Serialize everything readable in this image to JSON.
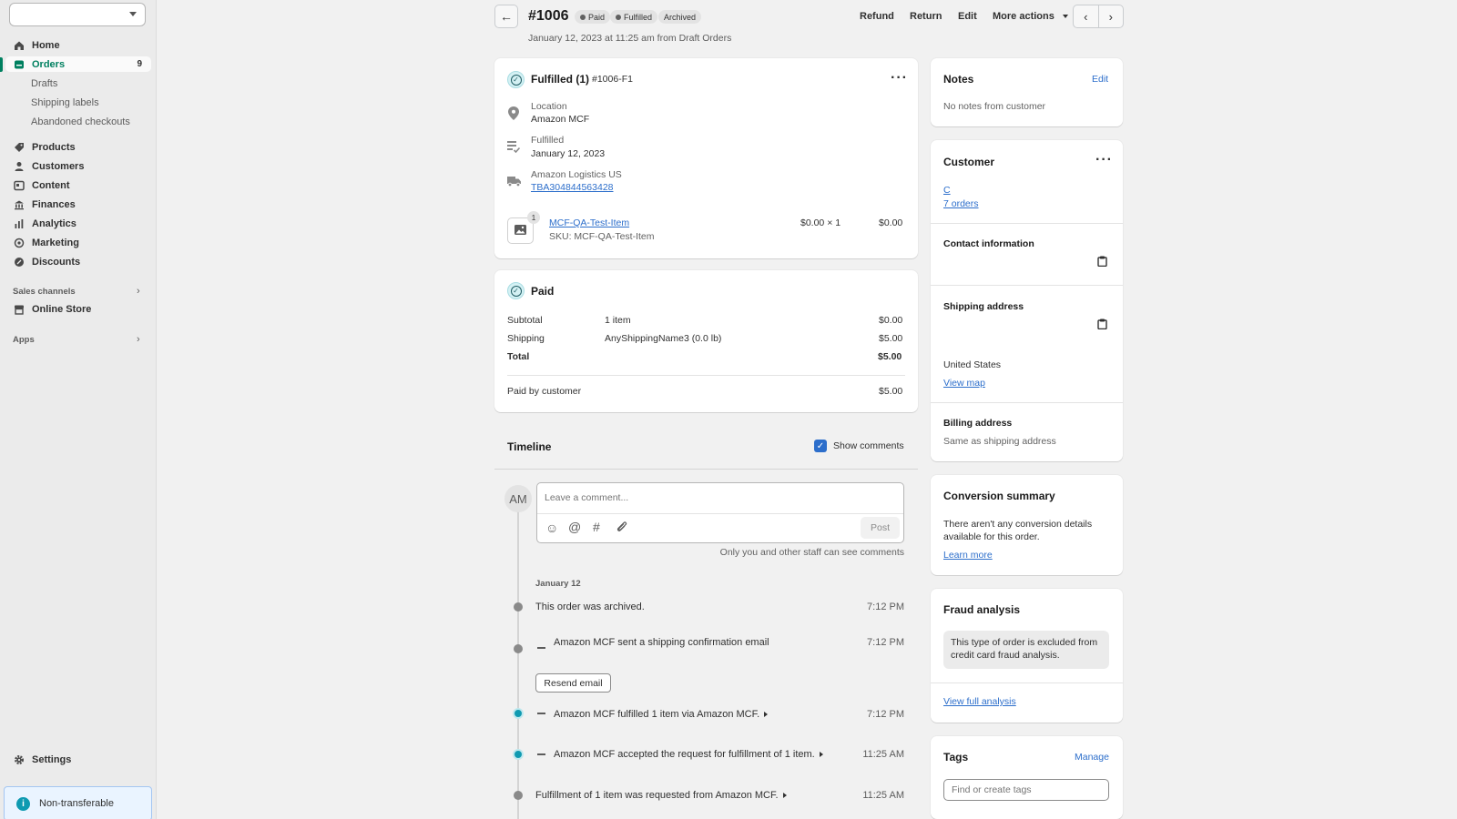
{
  "sidebar": {
    "store_select_value": "",
    "items": [
      {
        "label": "Home",
        "icon": "home-icon"
      },
      {
        "label": "Orders",
        "icon": "orders-icon",
        "badge": "9"
      },
      {
        "label": "Products",
        "icon": "tag-icon"
      },
      {
        "label": "Customers",
        "icon": "person-icon"
      },
      {
        "label": "Content",
        "icon": "content-icon"
      },
      {
        "label": "Finances",
        "icon": "bank-icon"
      },
      {
        "label": "Analytics",
        "icon": "bar-chart-icon"
      },
      {
        "label": "Marketing",
        "icon": "target-icon"
      },
      {
        "label": "Discounts",
        "icon": "discount-icon"
      }
    ],
    "order_subitems": [
      "Drafts",
      "Shipping labels",
      "Abandoned checkouts"
    ],
    "sales_channels_label": "Sales channels",
    "online_store_label": "Online Store",
    "apps_label": "Apps",
    "settings_label": "Settings",
    "non_transferable_label": "Non-transferable"
  },
  "header": {
    "order_number": "#1006",
    "badges": [
      "Paid",
      "Fulfilled",
      "Archived"
    ],
    "subtitle": "January 12, 2023 at 11:25 am from Draft Orders",
    "actions": [
      "Refund",
      "Return",
      "Edit",
      "More actions"
    ]
  },
  "fulfillment": {
    "title": "Fulfilled (1)",
    "id": "#1006-F1",
    "location_label": "Location",
    "location_value": "Amazon MCF",
    "fulfilled_label": "Fulfilled",
    "fulfilled_value": "January 12, 2023",
    "carrier_label": "Amazon Logistics US",
    "tracking": "TBA304844563428",
    "item": {
      "qty_badge": "1",
      "name": "MCF-QA-Test-Item",
      "sku": "SKU: MCF-QA-Test-Item",
      "unit": "$0.00 × 1",
      "total": "$0.00"
    }
  },
  "payment": {
    "title": "Paid",
    "rows": [
      {
        "label": "Subtotal",
        "detail": "1 item",
        "amount": "$0.00"
      },
      {
        "label": "Shipping",
        "detail": "AnyShippingName3 (0.0 lb)",
        "amount": "$5.00"
      },
      {
        "label": "Total",
        "detail": "",
        "amount": "$5.00"
      }
    ],
    "paid_by_label": "Paid by customer",
    "paid_by_amount": "$5.00"
  },
  "timeline": {
    "title": "Timeline",
    "show_comments_label": "Show comments",
    "avatar_initials": "AM",
    "comment_placeholder": "Leave a comment...",
    "post_label": "Post",
    "note": "Only you and other staff can see comments",
    "date_heading": "January 12",
    "events": [
      {
        "text": "This order was archived.",
        "time": "7:12 PM"
      },
      {
        "text": "Amazon MCF sent a shipping confirmation email",
        "time": "7:12 PM"
      },
      {
        "text": "Amazon MCF fulfilled 1 item via Amazon MCF.",
        "time": "7:12 PM"
      },
      {
        "text": "Amazon MCF accepted the request for fulfillment of 1 item.",
        "time": "11:25 AM"
      },
      {
        "text": "Fulfillment of 1 item was requested from Amazon MCF.",
        "time": "11:25 AM"
      }
    ],
    "resend_label": "Resend email"
  },
  "notes": {
    "title": "Notes",
    "edit_label": "Edit",
    "body": "No notes from customer"
  },
  "customer": {
    "title": "Customer",
    "name": "C",
    "orders_link": "7 orders",
    "contact_title": "Contact information",
    "shipping_title": "Shipping address",
    "shipping_country": "United States",
    "view_map": "View map",
    "billing_title": "Billing address",
    "billing_body": "Same as shipping address"
  },
  "conversion": {
    "title": "Conversion summary",
    "body": "There aren't any conversion details available for this order.",
    "link": "Learn more"
  },
  "fraud": {
    "title": "Fraud analysis",
    "body": "This type of order is excluded from credit card fraud analysis.",
    "link": "View full analysis"
  },
  "tags": {
    "title": "Tags",
    "manage_label": "Manage",
    "placeholder": "Find or create tags"
  },
  "colors": {
    "accent": "#008060",
    "link": "#2c6ecb",
    "teal": "#0f9ab1",
    "checkbox": "#2c6ecb"
  }
}
